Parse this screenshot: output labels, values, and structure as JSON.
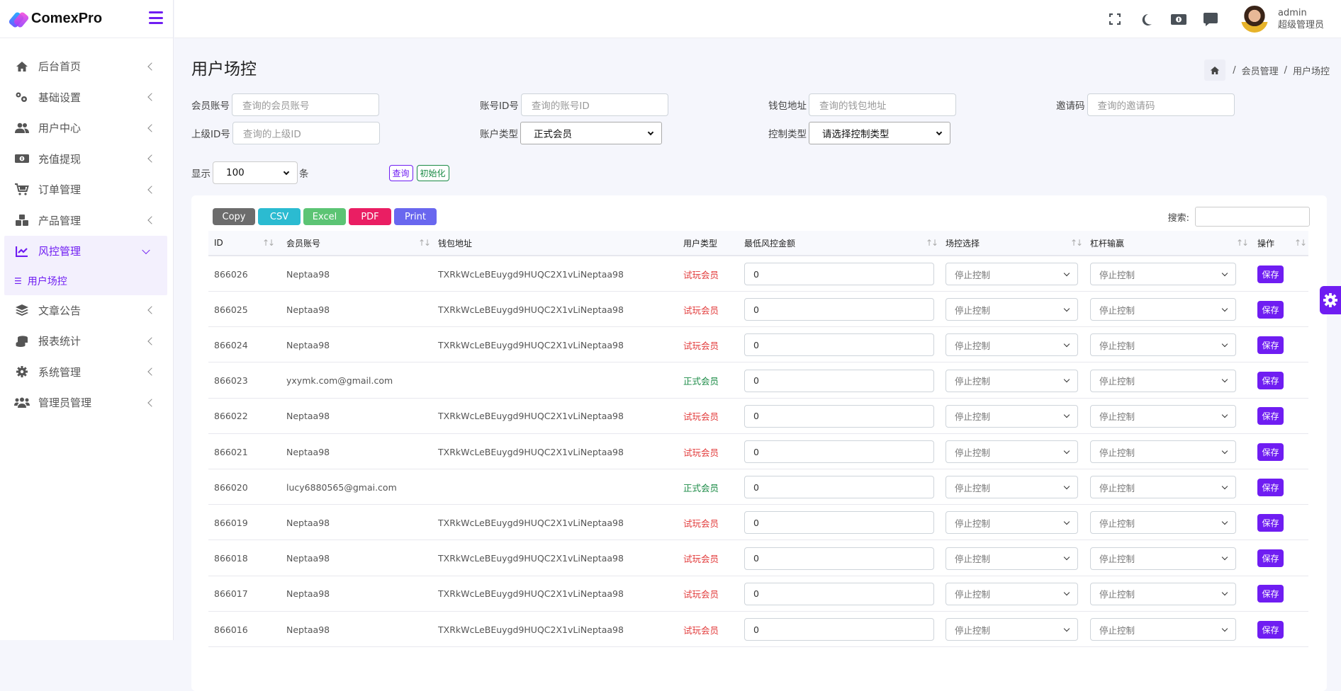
{
  "app": {
    "name": "ComexPro"
  },
  "sidebar": {
    "items": [
      {
        "label": "后台首页",
        "icon": "home-icon"
      },
      {
        "label": "基础设置",
        "icon": "gears-icon"
      },
      {
        "label": "用户中心",
        "icon": "users-icon"
      },
      {
        "label": "充值提现",
        "icon": "money-icon"
      },
      {
        "label": "订单管理",
        "icon": "cart-icon"
      },
      {
        "label": "产品管理",
        "icon": "cubes-icon"
      },
      {
        "label": "风控管理",
        "icon": "chart-line-icon",
        "expanded": true,
        "children": [
          {
            "label": "用户场控",
            "icon": "list-icon",
            "active": true
          }
        ]
      },
      {
        "label": "文章公告",
        "icon": "layers-icon"
      },
      {
        "label": "报表统计",
        "icon": "coins-icon"
      },
      {
        "label": "系统管理",
        "icon": "gear-icon"
      },
      {
        "label": "管理员管理",
        "icon": "user-group-icon"
      }
    ]
  },
  "header": {
    "icons": [
      "fullscreen-icon",
      "moon-icon",
      "money-icon",
      "comment-icon"
    ],
    "user": {
      "name": "admin",
      "role": "超级管理员"
    }
  },
  "page": {
    "title": "用户场控",
    "breadcrumb": [
      "会员管理",
      "用户场控"
    ]
  },
  "filters": {
    "member_account": {
      "label": "会员账号",
      "placeholder": "查询的会员账号"
    },
    "account_id": {
      "label": "账号ID号",
      "placeholder": "查询的账号ID"
    },
    "wallet": {
      "label": "钱包地址",
      "placeholder": "查询的钱包地址"
    },
    "invite": {
      "label": "邀请码",
      "placeholder": "查询的邀请码"
    },
    "parent_id": {
      "label": "上级ID号",
      "placeholder": "查询的上级ID"
    },
    "account_type": {
      "label": "账户类型",
      "value": "正式会员"
    },
    "control_type": {
      "label": "控制类型",
      "value": "请选择控制类型"
    },
    "show": {
      "label": "显示",
      "value": "100",
      "suffix": "条"
    },
    "query_button": "查询",
    "reset_button": "初始化"
  },
  "table": {
    "export_buttons": [
      {
        "label": "Copy",
        "color": "#6c6c6c"
      },
      {
        "label": "CSV",
        "color": "#2bbbd1"
      },
      {
        "label": "Excel",
        "color": "#5cc474"
      },
      {
        "label": "PDF",
        "color": "#ea1e63"
      },
      {
        "label": "Print",
        "color": "#6967ef"
      }
    ],
    "search_label": "搜索:",
    "columns": [
      "ID",
      "会员账号",
      "钱包地址",
      "用户类型",
      "最低风控金额",
      "场控选择",
      "杠杆输赢",
      "操作"
    ],
    "save_label": "保存",
    "rows": [
      {
        "id": "866026",
        "account": "Neptaa98",
        "wallet": "TXRkWcLeBEuygd9HUQC2X1vLiNeptaa98",
        "type": "试玩会员",
        "type_color": "#e23b3b",
        "min_amount": "0",
        "control": "停止控制",
        "leverage": "停止控制"
      },
      {
        "id": "866025",
        "account": "Neptaa98",
        "wallet": "TXRkWcLeBEuygd9HUQC2X1vLiNeptaa98",
        "type": "试玩会员",
        "type_color": "#e23b3b",
        "min_amount": "0",
        "control": "停止控制",
        "leverage": "停止控制"
      },
      {
        "id": "866024",
        "account": "Neptaa98",
        "wallet": "TXRkWcLeBEuygd9HUQC2X1vLiNeptaa98",
        "type": "试玩会员",
        "type_color": "#e23b3b",
        "min_amount": "0",
        "control": "停止控制",
        "leverage": "停止控制"
      },
      {
        "id": "866023",
        "account": "yxymk.com@gmail.com",
        "wallet": "",
        "type": "正式会员",
        "type_color": "#1a8a45",
        "min_amount": "0",
        "control": "停止控制",
        "leverage": "停止控制"
      },
      {
        "id": "866022",
        "account": "Neptaa98",
        "wallet": "TXRkWcLeBEuygd9HUQC2X1vLiNeptaa98",
        "type": "试玩会员",
        "type_color": "#e23b3b",
        "min_amount": "0",
        "control": "停止控制",
        "leverage": "停止控制"
      },
      {
        "id": "866021",
        "account": "Neptaa98",
        "wallet": "TXRkWcLeBEuygd9HUQC2X1vLiNeptaa98",
        "type": "试玩会员",
        "type_color": "#e23b3b",
        "min_amount": "0",
        "control": "停止控制",
        "leverage": "停止控制"
      },
      {
        "id": "866020",
        "account": "lucy6880565@gmai.com",
        "wallet": "",
        "type": "正式会员",
        "type_color": "#1a8a45",
        "min_amount": "0",
        "control": "停止控制",
        "leverage": "停止控制"
      },
      {
        "id": "866019",
        "account": "Neptaa98",
        "wallet": "TXRkWcLeBEuygd9HUQC2X1vLiNeptaa98",
        "type": "试玩会员",
        "type_color": "#e23b3b",
        "min_amount": "0",
        "control": "停止控制",
        "leverage": "停止控制"
      },
      {
        "id": "866018",
        "account": "Neptaa98",
        "wallet": "TXRkWcLeBEuygd9HUQC2X1vLiNeptaa98",
        "type": "试玩会员",
        "type_color": "#e23b3b",
        "min_amount": "0",
        "control": "停止控制",
        "leverage": "停止控制"
      },
      {
        "id": "866017",
        "account": "Neptaa98",
        "wallet": "TXRkWcLeBEuygd9HUQC2X1vLiNeptaa98",
        "type": "试玩会员",
        "type_color": "#e23b3b",
        "min_amount": "0",
        "control": "停止控制",
        "leverage": "停止控制"
      },
      {
        "id": "866016",
        "account": "Neptaa98",
        "wallet": "TXRkWcLeBEuygd9HUQC2X1vLiNeptaa98",
        "type": "试玩会员",
        "type_color": "#e23b3b",
        "min_amount": "0",
        "control": "停止控制",
        "leverage": "停止控制"
      }
    ]
  },
  "colors": {
    "accent": "#6f1df2",
    "reset": "#1a8a45"
  }
}
